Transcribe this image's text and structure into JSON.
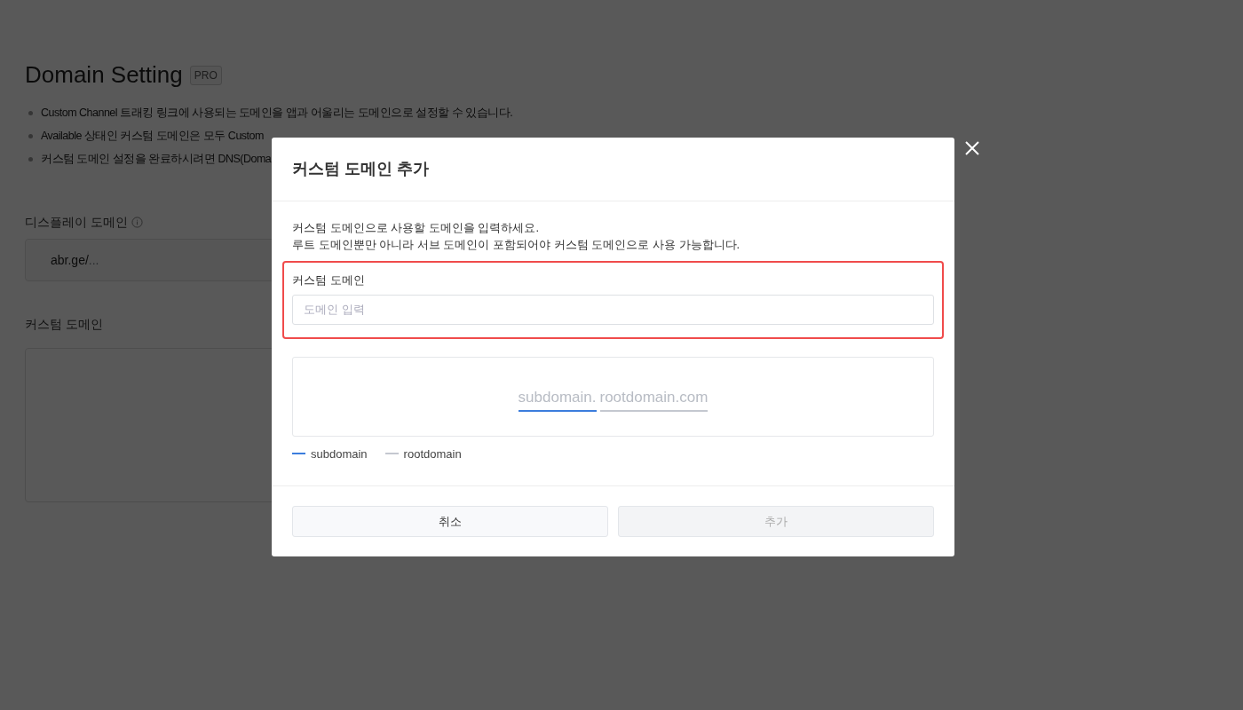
{
  "page": {
    "title": "Domain Setting",
    "badge": "PRO",
    "notes": [
      "Custom Channel 트래킹 링크에 사용되는 도메인을 앱과 어울리는 도메인으로 설정할 수 있습니다.",
      "Available 상태인 커스텀 도메인은 모두 Custom",
      "커스텀 도메인 설정을 완료하시려면 DNS(Doma"
    ],
    "display_domain": {
      "label": "디스플레이 도메인",
      "prefix": "abr.ge/",
      "placeholder": "..."
    },
    "custom_domain": {
      "label": "커스텀 도메인"
    }
  },
  "modal": {
    "title": "커스텀 도메인 추가",
    "description": [
      "커스텀 도메인으로 사용할 도메인을 입력하세요.",
      "루트 도메인뿐만 아니라 서브 도메인이 포함되어야 커스텀 도메인으로 사용 가능합니다."
    ],
    "field": {
      "label": "커스텀 도메인",
      "placeholder": "도메인 입력",
      "highlighted": true
    },
    "preview": [
      {
        "text": "subdomain.",
        "color": "#3b7ddd"
      },
      {
        "text": "rootdomain.com",
        "color": "#c4c8d0"
      }
    ],
    "legend": [
      {
        "label": "subdomain",
        "color": "#3b7ddd"
      },
      {
        "label": "rootdomain",
        "color": "#c4c8d0"
      }
    ],
    "buttons": [
      {
        "label": "취소",
        "disabled": false
      },
      {
        "label": "추가",
        "disabled": true
      }
    ]
  }
}
